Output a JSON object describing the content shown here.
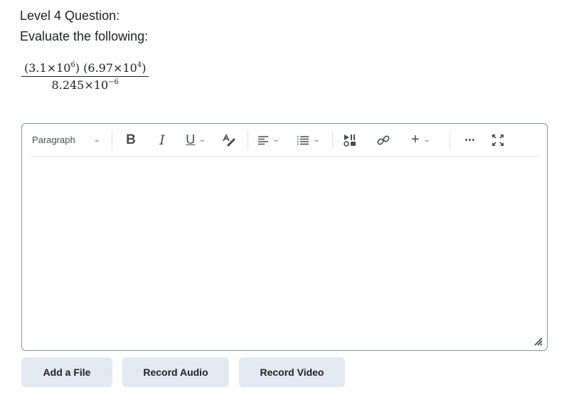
{
  "question": {
    "title": "Level 4 Question:",
    "prompt": "Evaluate the following:",
    "expression": {
      "numerator": {
        "a_mant": "(3.1×10",
        "a_exp": "6",
        "a_close": ")",
        "b_mant": "(6.97×10",
        "b_exp": "4",
        "b_close": ")"
      },
      "denominator": {
        "mant": "8.245×10",
        "exp": "−6"
      }
    }
  },
  "editor": {
    "toolbar": {
      "format_select": "Paragraph",
      "bold": "B",
      "italic": "I",
      "underline": "U",
      "more": "•••",
      "insert": "+"
    },
    "content": ""
  },
  "actions": {
    "add_file": "Add a File",
    "record_audio": "Record Audio",
    "record_video": "Record Video"
  }
}
